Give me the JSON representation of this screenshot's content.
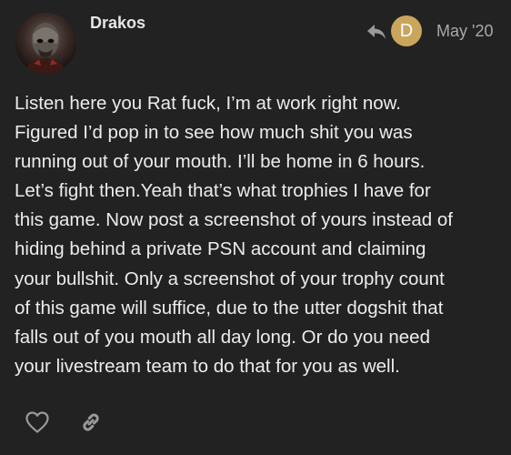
{
  "post": {
    "author": "Drakos",
    "avatar_icon": "user-avatar-masked-figure",
    "reply_to": {
      "icon": "reply-arrow-icon",
      "avatar_letter": "D",
      "avatar_color": "#c9a65b"
    },
    "date": "May '20",
    "body_lines": [
      "Listen here you Rat fuck, I’m at work right now.",
      "Figured I’d pop in to see how much shit you was",
      "running out of your mouth. I’ll be home in 6 hours.",
      "Let’s fight then.Yeah that’s what trophies I have for",
      "this game. Now post a screenshot of yours instead of",
      "hiding behind a private PSN account and claiming",
      "your bullshit. Only a screenshot of your trophy count",
      "of this game will suffice, due to the utter dogshit that",
      "falls out of you mouth all day long. Or do you need",
      "your livestream team to do that for you as well."
    ],
    "actions": [
      {
        "name": "like",
        "icon": "heart-icon"
      },
      {
        "name": "share",
        "icon": "link-icon"
      }
    ]
  },
  "colors": {
    "background": "#222222",
    "text": "#ececec",
    "muted": "#a8a8a8",
    "accent": "#c9a65b"
  }
}
